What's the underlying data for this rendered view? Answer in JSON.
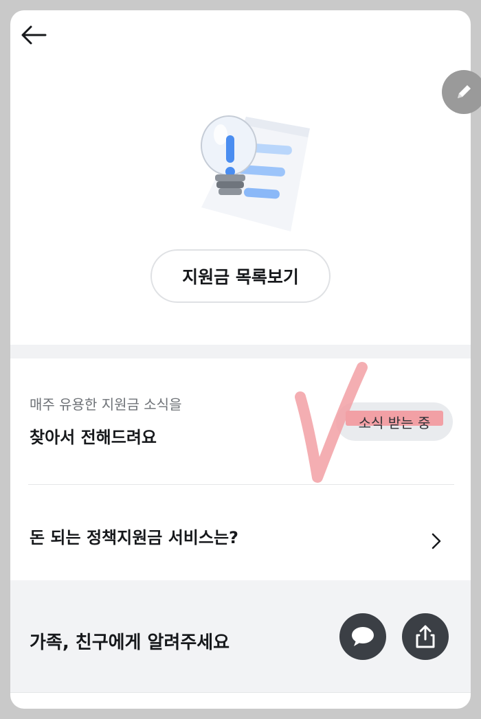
{
  "header": {
    "back_icon": "arrow-left-icon",
    "edit_icon": "pencil-icon"
  },
  "hero": {
    "illustration": "lightbulb-document-illustration",
    "list_button_label": "지원금 목록보기"
  },
  "news": {
    "subtitle": "매주 유용한 지원금 소식을",
    "title": "찾아서 전해드려요",
    "subscribe_status": "소식 받는 중",
    "highlight_color": "#f2a0a5",
    "annotation": "check-mark"
  },
  "service": {
    "label": "돈 되는 정책지원금 서비스는?",
    "chevron_icon": "chevron-right-icon"
  },
  "share": {
    "label": "가족, 친구에게 알려주세요",
    "kakao_icon": "speech-bubble-icon",
    "share_icon": "share-upload-icon"
  },
  "colors": {
    "text_primary": "#16181b",
    "text_secondary": "#6d7176",
    "button_dark": "#3b3f45",
    "panel_bg": "#f2f3f5",
    "accent_blue": "#4a8df0"
  }
}
